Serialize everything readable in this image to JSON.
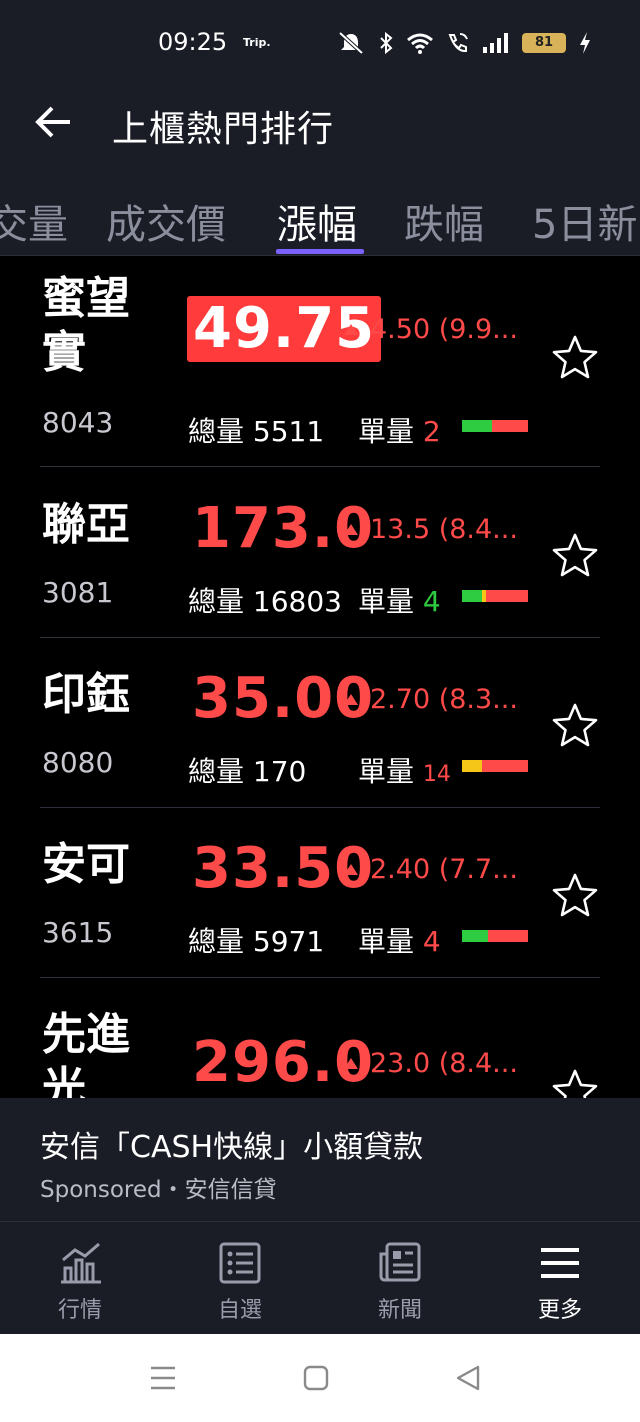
{
  "status_bar": {
    "time": "09:25",
    "trip_label": "Trip.",
    "battery": "81",
    "icons": [
      "mute-icon",
      "bluetooth-icon",
      "wifi-icon",
      "wifi-call-icon",
      "signal-icon",
      "battery-icon",
      "charging-icon"
    ]
  },
  "app_bar": {
    "title": "上櫃熱門排行",
    "back_icon": "back-arrow-icon"
  },
  "tabs": [
    {
      "label": "交量",
      "active": false
    },
    {
      "label": "成交價",
      "active": false
    },
    {
      "label": "漲幅",
      "active": true
    },
    {
      "label": "跌幅",
      "active": false
    },
    {
      "label": "5日新",
      "active": false
    }
  ],
  "colors": {
    "up": "#ff4a4a",
    "down": "#2ecc40",
    "accent": "#7b61ff",
    "neutral": "#f5c518",
    "background": "#000000",
    "panel": "#1a1c26"
  },
  "list": {
    "volume_label": "總量",
    "lot_label": "單量",
    "rows": [
      {
        "name": "蜜望實",
        "code": "8043",
        "price": "49.75",
        "highlight": true,
        "change": "4.50 (9.9...",
        "volume": "5511",
        "lot": "2",
        "lot_color": "#ff4a4a",
        "lot_small": false,
        "bar": [
          {
            "c": "#2ecc40",
            "p": 0.45
          },
          {
            "c": "#ff4a4a",
            "p": 0.55
          }
        ]
      },
      {
        "name": "聯亞",
        "code": "3081",
        "price": "173.0",
        "highlight": false,
        "change": "13.5 (8.4...",
        "volume": "16803",
        "lot": "4",
        "lot_color": "#2ecc40",
        "lot_small": false,
        "bar": [
          {
            "c": "#2ecc40",
            "p": 0.3
          },
          {
            "c": "#f5c518",
            "p": 0.06
          },
          {
            "c": "#ff4a4a",
            "p": 0.64
          }
        ]
      },
      {
        "name": "印鈺",
        "code": "8080",
        "price": "35.00",
        "highlight": false,
        "change": "2.70 (8.3...",
        "volume": "170",
        "lot": "14",
        "lot_color": "#ff4a4a",
        "lot_small": true,
        "bar": [
          {
            "c": "#f5c518",
            "p": 0.3
          },
          {
            "c": "#ff4a4a",
            "p": 0.7
          }
        ]
      },
      {
        "name": "安可",
        "code": "3615",
        "price": "33.50",
        "highlight": false,
        "change": "2.40 (7.7...",
        "volume": "5971",
        "lot": "4",
        "lot_color": "#ff4a4a",
        "lot_small": false,
        "bar": [
          {
            "c": "#2ecc40",
            "p": 0.4
          },
          {
            "c": "#ff4a4a",
            "p": 0.6
          }
        ]
      },
      {
        "name": "先進光",
        "code": "",
        "price": "296.0",
        "highlight": false,
        "change": "23.0 (8.4...",
        "volume": "",
        "lot": "",
        "lot_color": "#ff4a4a",
        "lot_small": false,
        "bar": []
      }
    ]
  },
  "ad": {
    "title": "安信「CASH快線」小額貸款",
    "sponsor": "Sponsored・安信信貸"
  },
  "bottom_nav": [
    {
      "label": "行情",
      "icon": "chart-icon",
      "active": false
    },
    {
      "label": "自選",
      "icon": "watchlist-icon",
      "active": false
    },
    {
      "label": "新聞",
      "icon": "news-icon",
      "active": false
    },
    {
      "label": "更多",
      "icon": "menu-icon",
      "active": true
    }
  ],
  "system_nav": [
    "recent-apps-icon",
    "home-icon",
    "back-icon"
  ]
}
